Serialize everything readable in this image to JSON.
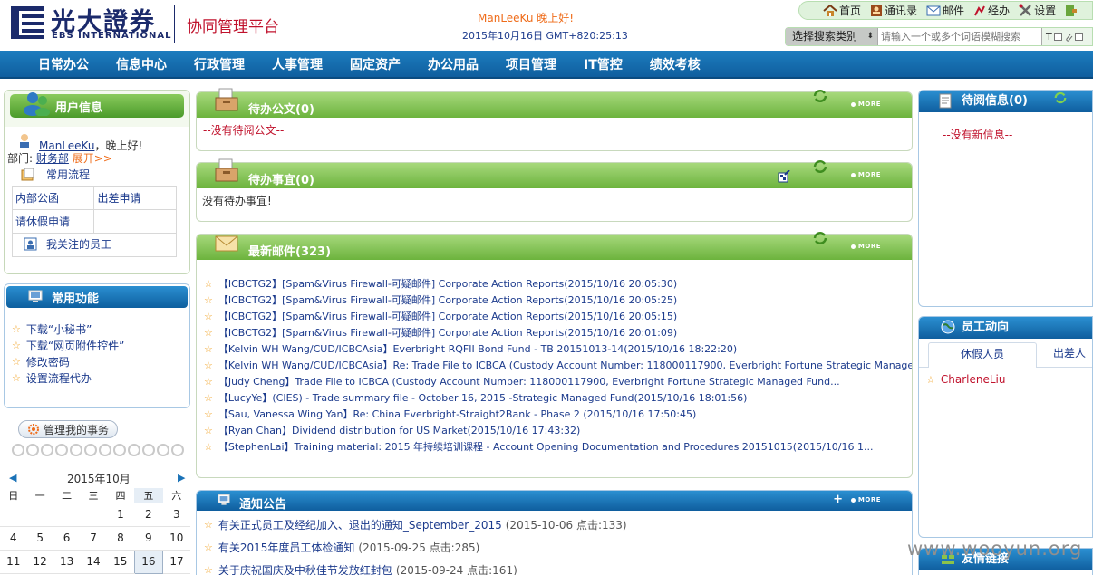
{
  "header": {
    "logo_cn": "光大證券",
    "logo_en": "EBS INTERNATIONAL",
    "platform": "协同管理平台",
    "greeting": "ManLeeKu   晚上好!",
    "datetime": "2015年10月16日 GMT+820:25:13"
  },
  "quicklinks": [
    {
      "label": "首页",
      "icon": "home-icon"
    },
    {
      "label": "通讯录",
      "icon": "contacts-icon"
    },
    {
      "label": "邮件",
      "icon": "mail-icon"
    },
    {
      "label": "经办",
      "icon": "handled-icon"
    },
    {
      "label": "设置",
      "icon": "tools-icon"
    }
  ],
  "search": {
    "category": "选择搜索类别",
    "placeholder": "请输入一个或多个词语模糊搜索",
    "opt_t": "T"
  },
  "nav": [
    "日常办公",
    "信息中心",
    "行政管理",
    "人事管理",
    "固定资产",
    "办公用品",
    "项目管理",
    "IT管控",
    "绩效考核"
  ],
  "user_panel": {
    "title": "用户信息",
    "user": "ManLeeKu",
    "greeting": "，晚上好!",
    "dept_label": "部门:",
    "dept": "财务部",
    "expand": "展开>>",
    "flow_title": "常用流程",
    "flows": [
      [
        "内部公函",
        "出差申请"
      ],
      [
        "请休假申请",
        ""
      ]
    ],
    "followed": "我关注的员工"
  },
  "func_panel": {
    "title": "常用功能",
    "items": [
      "下载“小秘书”",
      "下载“网页附件控件”",
      "修改密码",
      "设置流程代办"
    ]
  },
  "manage_button": "管理我的事务",
  "calendar": {
    "title": "2015年10月",
    "weekdays": [
      "日",
      "一",
      "二",
      "三",
      "四",
      "五",
      "六"
    ],
    "today": "16",
    "rows": [
      [
        "",
        "",
        "",
        "",
        "1",
        "2",
        "3"
      ],
      [
        "4",
        "5",
        "6",
        "7",
        "8",
        "9",
        "10"
      ],
      [
        "11",
        "12",
        "13",
        "14",
        "15",
        "16",
        "17"
      ]
    ]
  },
  "pending_docs": {
    "title": "待办公文(0)",
    "empty": "--没有待阅公文--"
  },
  "pending_tasks": {
    "title": "待办事宜(0)",
    "empty": "没有待办事宜!"
  },
  "mail": {
    "title": "最新邮件(323)",
    "items": [
      "【ICBCTG2】[Spam&Virus Firewall-可疑邮件] Corporate Action Reports(2015/10/16 20:05:30)",
      "【ICBCTG2】[Spam&Virus Firewall-可疑邮件] Corporate Action Reports(2015/10/16 20:05:25)",
      "【ICBCTG2】[Spam&Virus Firewall-可疑邮件] Corporate Action Reports(2015/10/16 20:05:15)",
      "【ICBCTG2】[Spam&Virus Firewall-可疑邮件] Corporate Action Reports(2015/10/16 20:01:09)",
      "【Kelvin WH Wang/CUD/ICBCAsia】Everbright RQFII Bond Fund - TB 20151013-14(2015/10/16 18:22:20)",
      "【Kelvin WH Wang/CUD/ICBCAsia】Re: Trade File to ICBCA (Custody Account Number: 118000117900, Everbright Fortune Strategic Managed ...",
      "【Judy Cheng】Trade File to ICBCA (Custody Account Number: 118000117900, Everbright Fortune Strategic Managed Fund...",
      "【LucyYe】(CIES) - Trade summary file - October 16, 2015 -Strategic Managed Fund(2015/10/16 18:01:56)",
      "【Sau, Vanessa Wing Yan】Re: China Everbright-Straight2Bank - Phase 2 (2015/10/16 17:50:45)",
      "【Ryan Chan】Dividend distribution for US Market(2015/10/16 17:43:32)",
      "【StephenLai】Training material: 2015 年持续培训课程 - Account Opening Documentation and Procedures 20151015(2015/10/16 1..."
    ]
  },
  "notices": {
    "title": "通知公告",
    "items": [
      {
        "text": "有关正式员工及经纪加入、退出的通知_September_2015",
        "meta": "(2015-10-06    点击:133)"
      },
      {
        "text": "有关2015年度员工体检通知",
        "meta": "(2015-09-25    点击:285)"
      },
      {
        "text": "关于庆祝国庆及中秋佳节发放红封包",
        "meta": "(2015-09-24    点击:161)"
      }
    ]
  },
  "more_label": "MORE",
  "unread": {
    "title": "待阅信息(0)",
    "empty": "--没有新信息--"
  },
  "staff": {
    "title": "员工动向",
    "tab_leave": "休假人员",
    "tab_trip": "出差人",
    "people": [
      "CharleneLiu"
    ]
  },
  "links_title": "友情链接",
  "watermark": "www.wooyun.org",
  "colors": {
    "nav_blue": "#0f5e9e",
    "panel_green": "#6cb33d",
    "alert_red": "#c0122c",
    "greet_orange": "#ef6c1a"
  }
}
